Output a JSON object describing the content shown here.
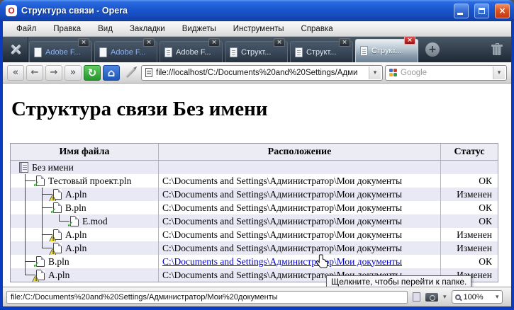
{
  "titlebar": {
    "title": "Структура связи - Opera",
    "logo_letter": "O"
  },
  "menubar": {
    "items": [
      "Файл",
      "Правка",
      "Вид",
      "Закладки",
      "Виджеты",
      "Инструменты",
      "Справка"
    ]
  },
  "tabbar": {
    "tabs": [
      {
        "label": "Adobe F...",
        "loaded": false,
        "active": false
      },
      {
        "label": "Adobe F...",
        "loaded": false,
        "active": false
      },
      {
        "label": "Adobe F...",
        "loaded": true,
        "active": false
      },
      {
        "label": "Структ...",
        "loaded": true,
        "active": false
      },
      {
        "label": "Структ...",
        "loaded": true,
        "active": false
      },
      {
        "label": "Структ...",
        "loaded": true,
        "active": true
      }
    ]
  },
  "addressbar": {
    "url": "file://localhost/C:/Documents%20and%20Settings/Адми",
    "search_placeholder": "Google"
  },
  "page": {
    "heading": "Структура связи Без имени",
    "table": {
      "headers": [
        "Имя файла",
        "Расположение",
        "Статус"
      ],
      "rows": [
        {
          "tree": [],
          "icon": "root",
          "name": "Без имени",
          "location": "",
          "status": "",
          "link": false
        },
        {
          "tree": [
            "b"
          ],
          "icon": "ok",
          "name": "Тестовый проект.pln",
          "location": "C:\\Documents and Settings\\Администратор\\Мои документы",
          "status": "ОК",
          "link": false
        },
        {
          "tree": [
            "v",
            "b"
          ],
          "icon": "warn",
          "name": "A.pln",
          "location": "C:\\Documents and Settings\\Администратор\\Мои документы",
          "status": "Изменен",
          "link": false
        },
        {
          "tree": [
            "v",
            "b"
          ],
          "icon": "ok",
          "name": "B.pln",
          "location": "C:\\Documents and Settings\\Администратор\\Мои документы",
          "status": "ОК",
          "link": false
        },
        {
          "tree": [
            "v",
            "v",
            "e"
          ],
          "icon": "ok",
          "name": "E.mod",
          "location": "C:\\Documents and Settings\\Администратор\\Мои документы",
          "status": "ОК",
          "link": false
        },
        {
          "tree": [
            "v",
            "b"
          ],
          "icon": "warn",
          "name": "A.pln",
          "location": "C:\\Documents and Settings\\Администратор\\Мои документы",
          "status": "Изменен",
          "link": false
        },
        {
          "tree": [
            "v",
            "e"
          ],
          "icon": "warn",
          "name": "A.pln",
          "location": "C:\\Documents and Settings\\Администратор\\Мои документы",
          "status": "Изменен",
          "link": false
        },
        {
          "tree": [
            "b"
          ],
          "icon": "ok",
          "name": "B.pln",
          "location": "C:\\Documents and Settings\\Администратор\\Мои документы",
          "status": "ОК",
          "link": true
        },
        {
          "tree": [
            "e"
          ],
          "icon": "warn",
          "name": "A.pln",
          "location": "C:\\Documents and Settings\\Администратор\\Мои документы",
          "status": "Изменен",
          "link": false
        }
      ]
    }
  },
  "tooltip": {
    "text": "Щелкните, чтобы перейти к папке."
  },
  "statusbar": {
    "path": "file:/C:/Documents%20and%20Settings/Администратор/Мои%20документы",
    "zoom_level": "100%"
  },
  "glyphs": {
    "close": "×",
    "dropdown": "▾",
    "rewind": "«",
    "back": "←",
    "forward": "→",
    "fastforward": "»",
    "reload": "↻",
    "home": "⌂",
    "plus": "+",
    "check": "✓",
    "warn_triangle": "▲"
  },
  "colors": {
    "titlebar_blue": "#1b55cc",
    "window_border": "#0a3bc0",
    "link_blue": "#0000cc",
    "row_alt": "#e9e9f6",
    "status_ok_green": "#13a10e",
    "warn_yellow": "#f0e13c",
    "active_close_red": "#c21212"
  }
}
